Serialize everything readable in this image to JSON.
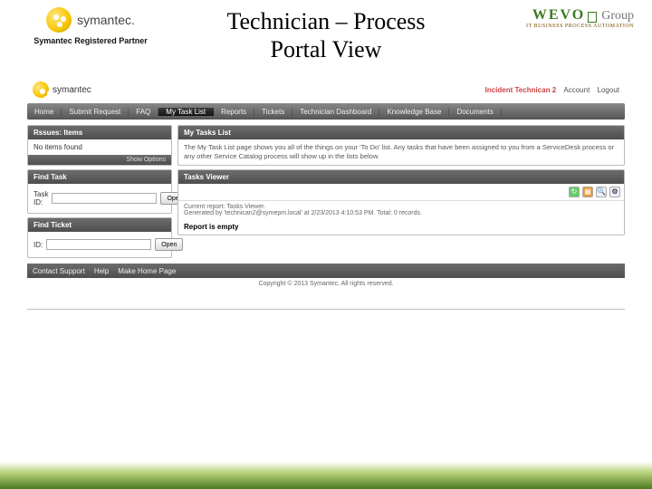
{
  "header": {
    "symantec": "symantec.",
    "partner": "Symantec Registered Partner",
    "title_line1": "Technician – Process",
    "title_line2": "Portal View",
    "wevo": "WEVO",
    "wevo_script": "Group",
    "wevo_tag": "IT BUSINESS PROCESS AUTOMATION"
  },
  "portal": {
    "logo": "symantec",
    "role": "Incident Technican 2",
    "account": "Account",
    "logout": "Logout"
  },
  "nav": {
    "items": [
      "Home",
      "Submit Request",
      "FAQ",
      "My Task List",
      "Reports",
      "Tickets",
      "Technician Dashboard",
      "Knowledge Base",
      "Documents"
    ],
    "activeIndex": 3
  },
  "panels": {
    "rssues": {
      "title": "Rssues: Items",
      "empty": "No items found",
      "show_options": "Show Options"
    },
    "find_task": {
      "title": "Find Task",
      "label": "Task ID:",
      "open": "Open"
    },
    "find_ticket": {
      "title": "Find Ticket",
      "label": "ID:",
      "open": "Open"
    },
    "tasks_list": {
      "title": "My Tasks List",
      "desc": "The My Task List page shows you all of the things on your 'To Do' list. Any tasks that have been assigned to you from a ServiceDesk process or any other Service Catalog process will show up in the lists below."
    },
    "tasks_viewer": {
      "title": "Tasks Viewer",
      "report_line1": "Current report: Tasks Viewer.",
      "report_line2": "Generated by 'technican2@symepm.local' at 2/23/2013 4:10:53 PM. Total: 0 records.",
      "empty": "Report is empty"
    }
  },
  "footer": {
    "contact": "Contact Support",
    "help": "Help",
    "home": "Make Home Page",
    "copyright": "Copyright © 2013 Symantec. All rights reserved."
  }
}
